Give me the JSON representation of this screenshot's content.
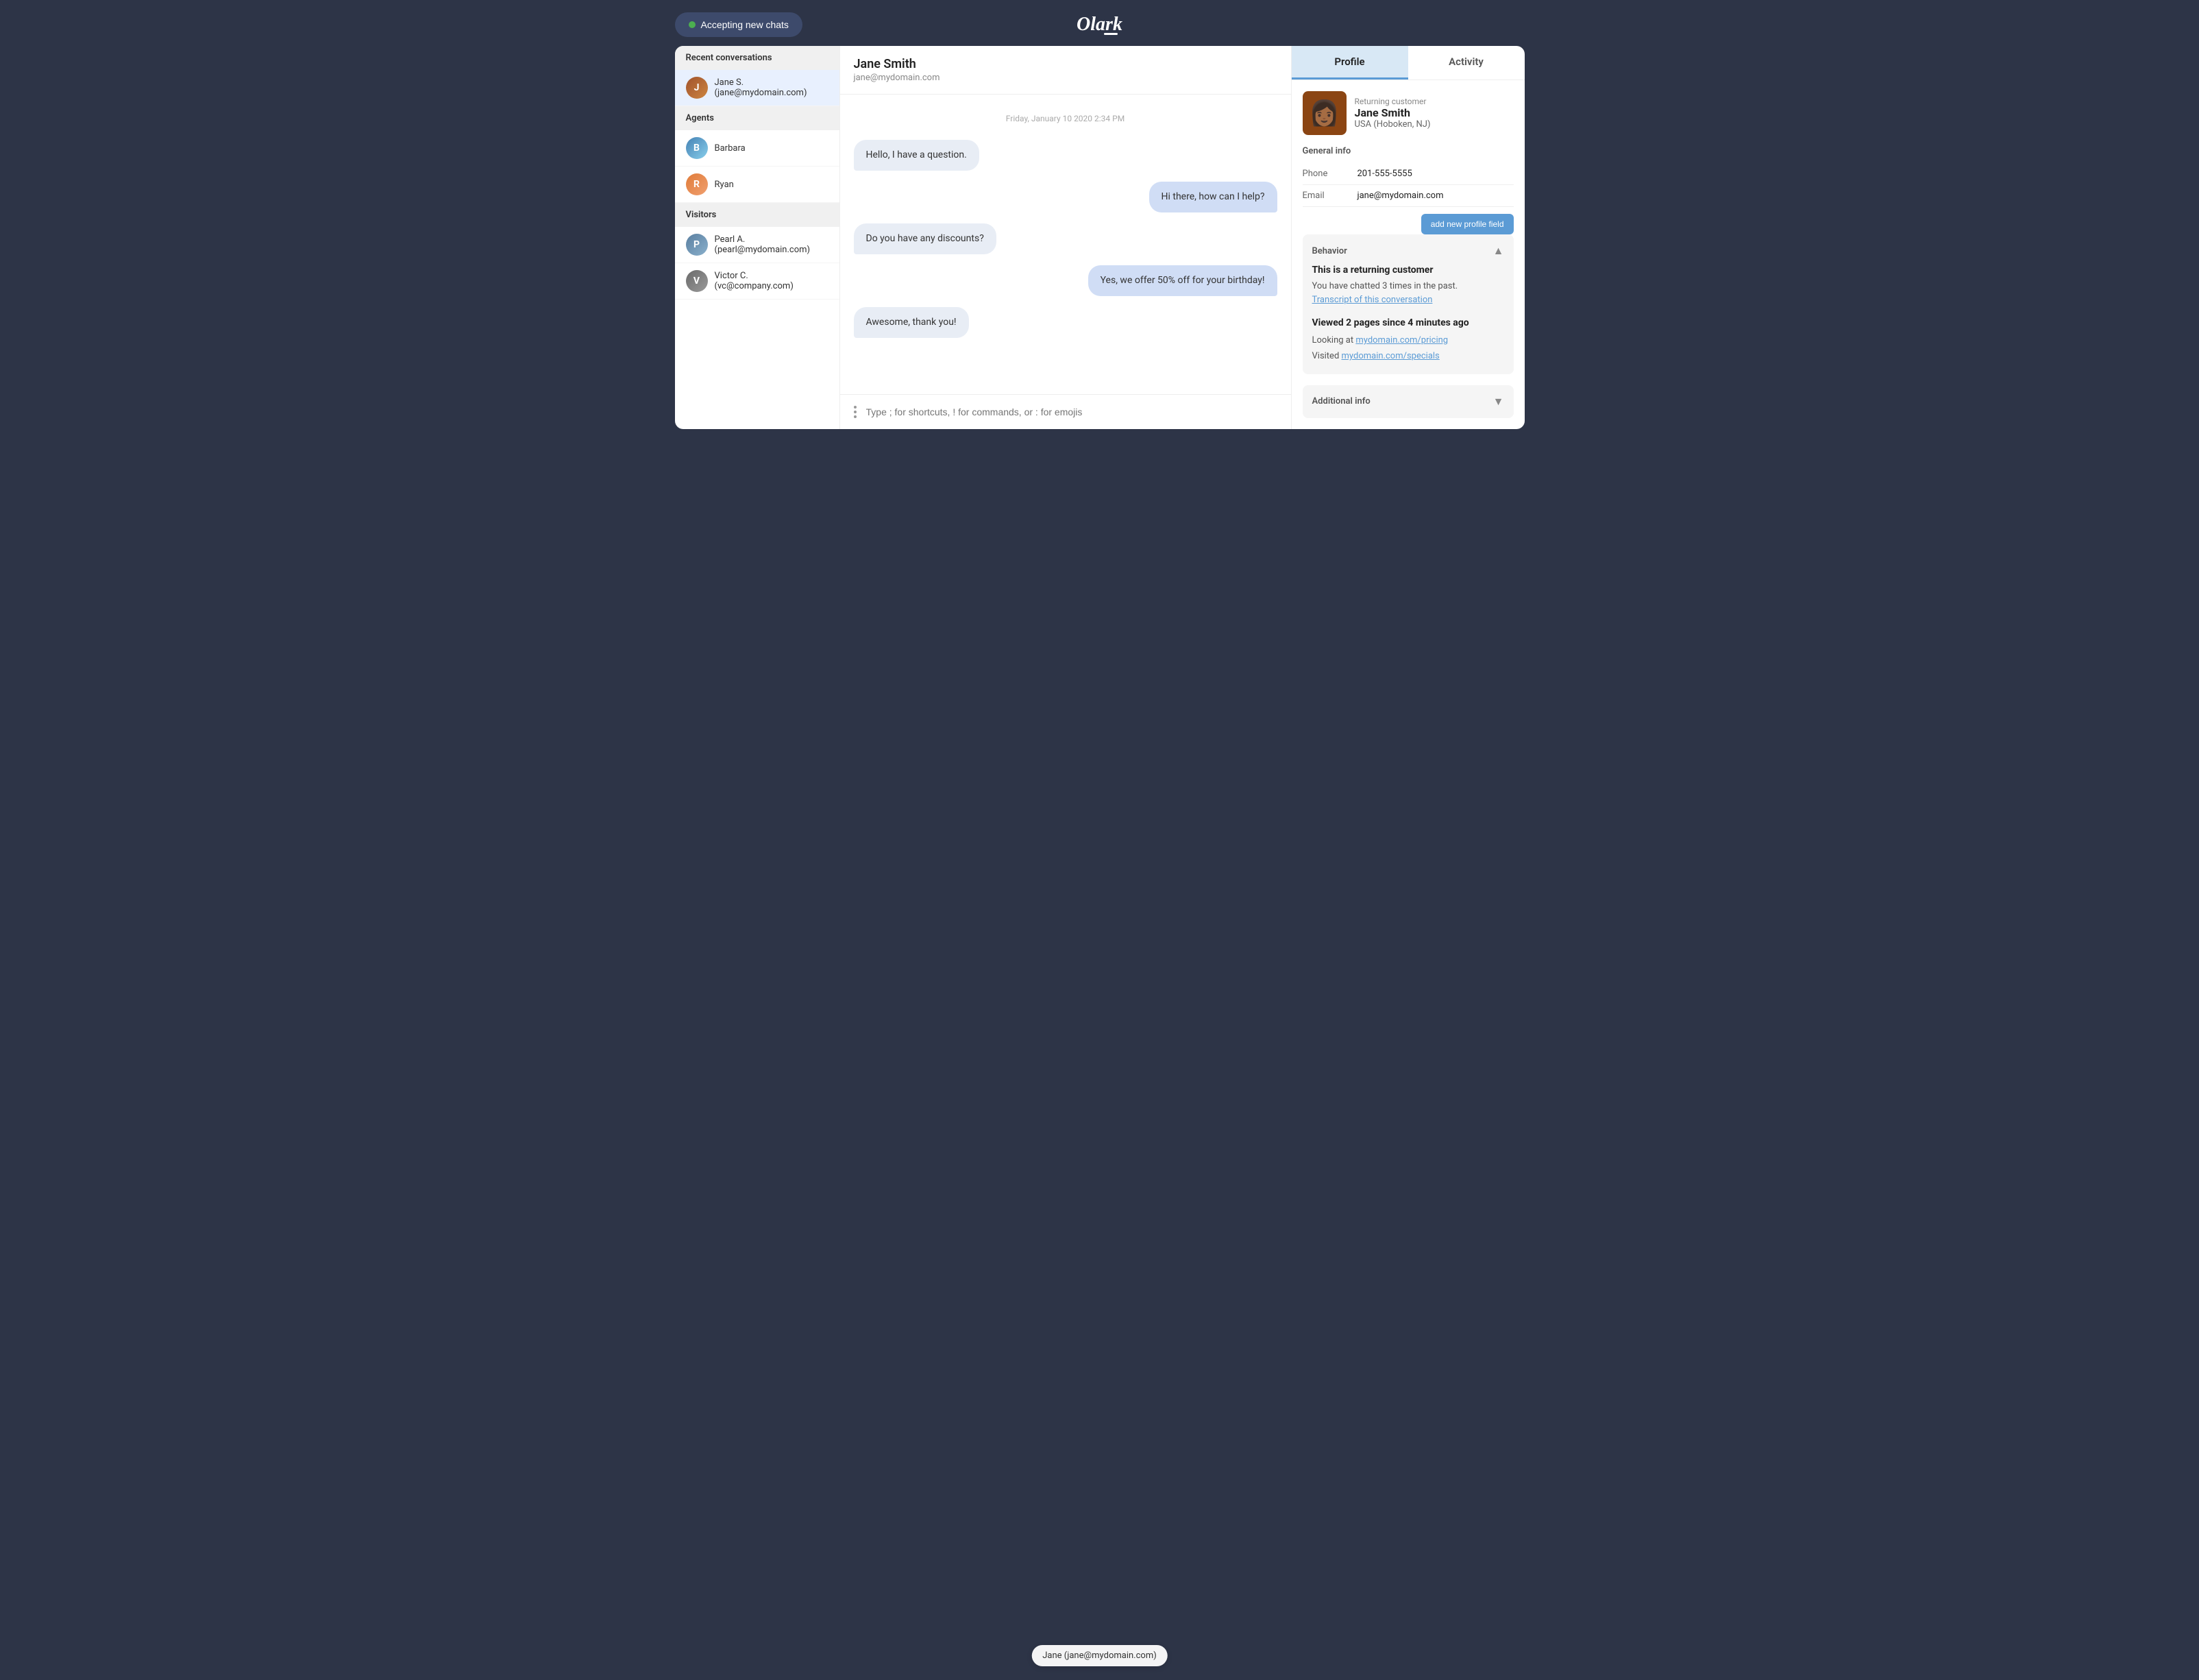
{
  "header": {
    "accepting_label": "Accepting new chats",
    "logo_text": "Olark"
  },
  "sidebar": {
    "recent_conversations_title": "Recent conversations",
    "recent_items": [
      {
        "name": "Jane S. (jane@mydomain.com)",
        "avatar": "jane"
      }
    ],
    "agents_title": "Agents",
    "agents": [
      {
        "name": "Barbara",
        "avatar": "barbara"
      },
      {
        "name": "Ryan",
        "avatar": "ryan"
      }
    ],
    "visitors_title": "Visitors",
    "visitors": [
      {
        "name": "Pearl A. (pearl@mydomain.com)",
        "avatar": "pearl"
      },
      {
        "name": "Victor C. (vc@company.com)",
        "avatar": "victor"
      }
    ]
  },
  "chat": {
    "contact_name": "Jane Smith",
    "contact_email": "jane@mydomain.com",
    "date_divider": "Friday, January 10 2020 2:34 PM",
    "messages": [
      {
        "text": "Hello, I have a question.",
        "direction": "incoming"
      },
      {
        "text": "Hi there, how can I help?",
        "direction": "outgoing"
      },
      {
        "text": "Do you have any discounts?",
        "direction": "incoming"
      },
      {
        "text": "Yes, we offer 50% off for your birthday!",
        "direction": "outgoing"
      },
      {
        "text": "Awesome, thank you!",
        "direction": "incoming"
      }
    ],
    "input_placeholder": "Type ; for shortcuts, ! for commands, or : for emojis"
  },
  "profile": {
    "tabs": [
      {
        "label": "Profile",
        "active": true
      },
      {
        "label": "Activity",
        "active": false
      }
    ],
    "customer_type": "Returning customer",
    "name": "Jane Smith",
    "location": "USA (Hoboken, NJ)",
    "general_info_title": "General info",
    "phone_label": "Phone",
    "phone_value": "201-555-5555",
    "email_label": "Email",
    "email_value": "jane@mydomain.com",
    "add_profile_btn": "add new profile field",
    "behavior_title": "Behavior",
    "behavior_returning_title": "This is a returning customer",
    "behavior_text_1": "You have chatted 3 times in the past.",
    "behavior_link": "Transcript of this conversation",
    "viewed_title": "Viewed 2 pages since 4 minutes ago",
    "looking_at_prefix": "Looking at ",
    "looking_at_link": "mydomain.com/pricing",
    "visited_prefix": "Visited ",
    "visited_link": "mydomain.com/specials",
    "additional_info_title": "Additional info"
  },
  "footer": {
    "typing_indicator": "Jane (jane@mydomain.com)"
  }
}
